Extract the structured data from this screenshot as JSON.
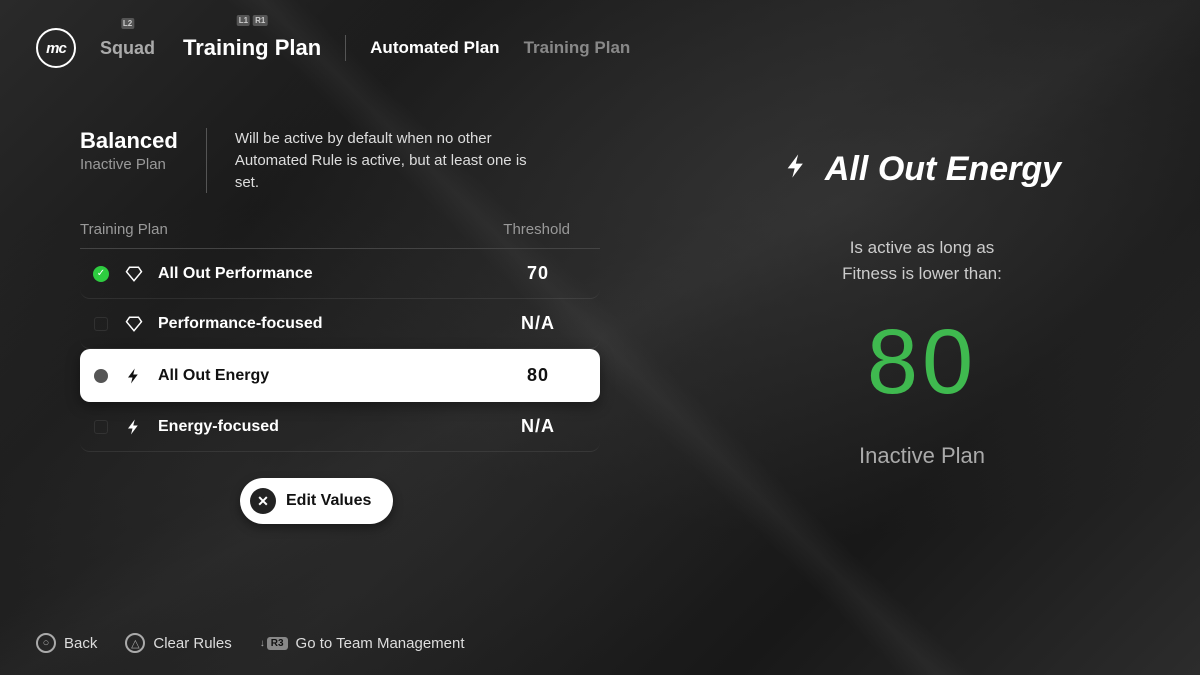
{
  "nav": {
    "squad": "Squad",
    "training_plan": "Training Plan"
  },
  "sub_nav": {
    "automated": "Automated Plan",
    "training": "Training Plan"
  },
  "plan": {
    "title": "Balanced",
    "subtitle": "Inactive Plan",
    "description": "Will be active by default when no other Automated Rule is active, but at least one is set."
  },
  "table": {
    "head_plan": "Training Plan",
    "head_threshold": "Threshold",
    "rows": [
      {
        "label": "All Out Performance",
        "threshold": "70"
      },
      {
        "label": "Performance-focused",
        "threshold": "N/A"
      },
      {
        "label": "All Out Energy",
        "threshold": "80"
      },
      {
        "label": "Energy-focused",
        "threshold": "N/A"
      }
    ]
  },
  "edit_button": "Edit Values",
  "detail": {
    "title": "All Out Energy",
    "condition_line1": "Is active as long as",
    "condition_line2": "Fitness is lower than:",
    "value": "80",
    "status": "Inactive Plan"
  },
  "footer": {
    "back": "Back",
    "clear": "Clear Rules",
    "team_mgmt": "Go to Team Management"
  }
}
